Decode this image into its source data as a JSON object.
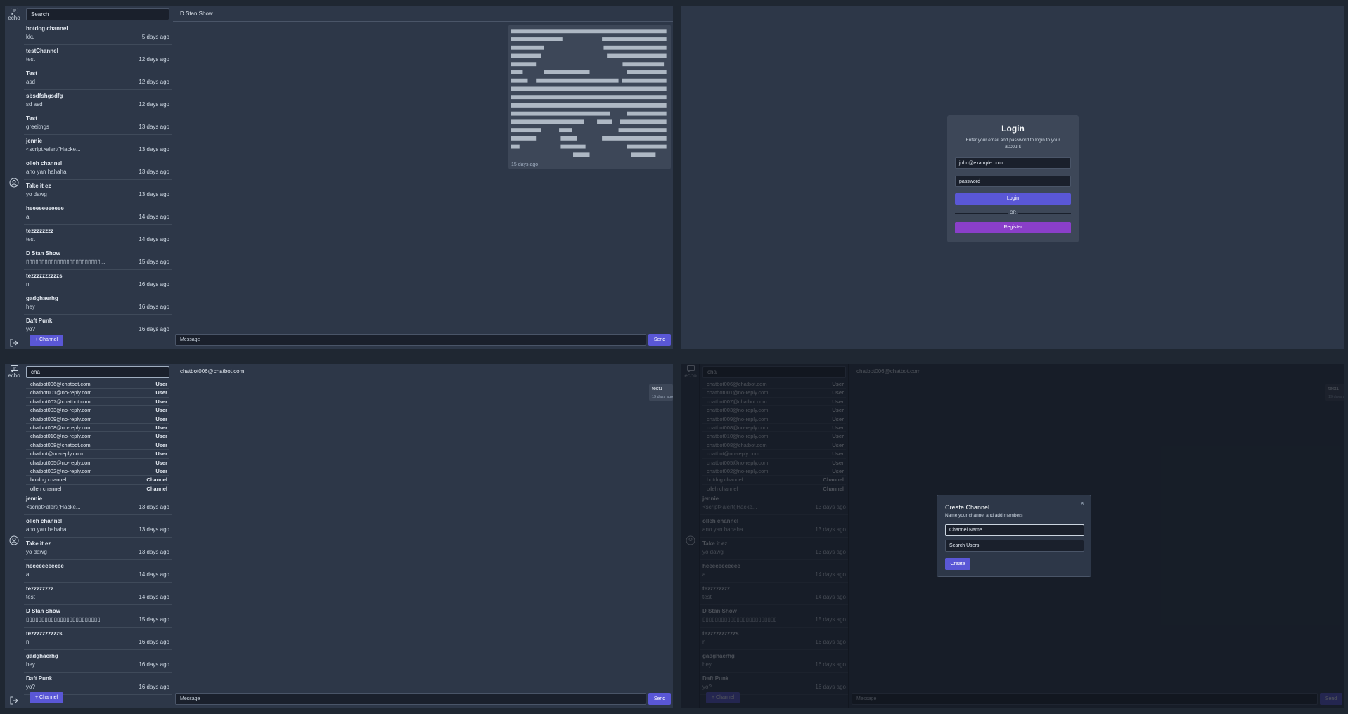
{
  "app": {
    "name": "echo"
  },
  "panel1": {
    "search_placeholder": "Search",
    "chat_title": "D Stan Show",
    "message_placeholder": "Message",
    "send_label": "Send",
    "add_channel_label": "+ Channel",
    "bubble_time": "15 days ago",
    "channels": [
      {
        "name": "hotdog channel",
        "last": "kku",
        "time": "5 days ago"
      },
      {
        "name": "testChannel",
        "last": "test",
        "time": "12 days ago"
      },
      {
        "name": "Test",
        "last": "asd",
        "time": "12 days ago"
      },
      {
        "name": "sbsdfshgsdfg",
        "last": "sd asd",
        "time": "12 days ago"
      },
      {
        "name": "Test",
        "last": "greeitngs",
        "time": "13 days ago"
      },
      {
        "name": "jennie",
        "last": "<script>alert('Hacke...",
        "time": "13 days ago"
      },
      {
        "name": "olleh channel",
        "last": "ano yan hahaha",
        "time": "13 days ago"
      },
      {
        "name": "Take it ez",
        "last": "yo dawg",
        "time": "13 days ago"
      },
      {
        "name": "heeeeeeeeeee",
        "last": "a",
        "time": "14 days ago"
      },
      {
        "name": "tezzzzzzzz",
        "last": "test",
        "time": "14 days ago"
      },
      {
        "name": "D Stan Show",
        "last": "▯▯▯▯▯▯▯▯▯▯▯▯▯▯▯▯▯▯▯▯▯▯▯▯...",
        "time": "15 days ago"
      },
      {
        "name": "tezzzzzzzzzzs",
        "last": "n",
        "time": "16 days ago"
      },
      {
        "name": "gadghaerhg",
        "last": "hey",
        "time": "16 days ago"
      },
      {
        "name": "Daft Punk",
        "last": "yo?",
        "time": "16 days ago"
      }
    ]
  },
  "login": {
    "title": "Login",
    "subtitle": "Enter your email and password to login to your account",
    "email_placeholder": "john@example.com",
    "password_placeholder": "password",
    "login_label": "Login",
    "or_label": "OR",
    "register_label": "Register",
    "colors": {
      "login": "#5a57d6",
      "register": "#8a3fc9"
    }
  },
  "panel3": {
    "search_value": "cha",
    "chat_title": "chatbot006@chatbot.com",
    "message_placeholder": "Message",
    "send_label": "Send",
    "add_channel_label": "+ Channel",
    "bubble_text": "test1",
    "bubble_time": "19 days ago",
    "results": [
      {
        "name": "chatbot006@chatbot.com",
        "type": "User"
      },
      {
        "name": "chatbot001@no-reply.com",
        "type": "User"
      },
      {
        "name": "chatbot007@chatbot.com",
        "type": "User"
      },
      {
        "name": "chatbot003@no-reply.com",
        "type": "User"
      },
      {
        "name": "chatbot009@no-reply.com",
        "type": "User"
      },
      {
        "name": "chatbot008@no-reply.com",
        "type": "User"
      },
      {
        "name": "chatbot010@no-reply.com",
        "type": "User"
      },
      {
        "name": "chatbot008@chatbot.com",
        "type": "User"
      },
      {
        "name": "chatbot@no-reply.com",
        "type": "User"
      },
      {
        "name": "chatbot005@no-reply.com",
        "type": "User"
      },
      {
        "name": "chatbot002@no-reply.com",
        "type": "User"
      },
      {
        "name": "hotdog channel",
        "type": "Channel"
      },
      {
        "name": "olleh channel",
        "type": "Channel"
      }
    ],
    "channels": [
      {
        "name": "jennie",
        "last": "<script>alert('Hacke...",
        "time": "13 days ago"
      },
      {
        "name": "olleh channel",
        "last": "ano yan hahaha",
        "time": "13 days ago"
      },
      {
        "name": "Take it ez",
        "last": "yo dawg",
        "time": "13 days ago"
      },
      {
        "name": "heeeeeeeeeee",
        "last": "a",
        "time": "14 days ago"
      },
      {
        "name": "tezzzzzzzz",
        "last": "test",
        "time": "14 days ago"
      },
      {
        "name": "D Stan Show",
        "last": "▯▯▯▯▯▯▯▯▯▯▯▯▯▯▯▯▯▯▯▯▯▯▯▯...",
        "time": "15 days ago"
      },
      {
        "name": "tezzzzzzzzzzs",
        "last": "n",
        "time": "16 days ago"
      },
      {
        "name": "gadghaerhg",
        "last": "hey",
        "time": "16 days ago"
      },
      {
        "name": "Daft Punk",
        "last": "yo?",
        "time": "16 days ago"
      }
    ]
  },
  "modal": {
    "title": "Create Channel",
    "subtitle": "Name your channel and add members",
    "close_glyph": "×",
    "name_placeholder": "Channel Name",
    "users_placeholder": "Search Users",
    "create_label": "Create"
  }
}
